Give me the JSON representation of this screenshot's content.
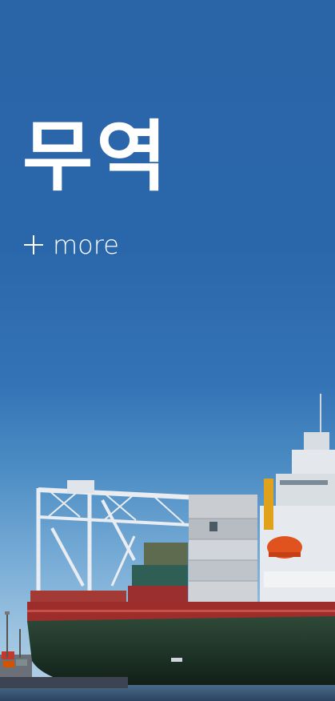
{
  "banner": {
    "title": "무역",
    "more_label": "more",
    "more_icon": "plus-icon",
    "background_color": "#2a66aa"
  },
  "scene": {
    "ship_illustration": "cargo-ship-image"
  }
}
